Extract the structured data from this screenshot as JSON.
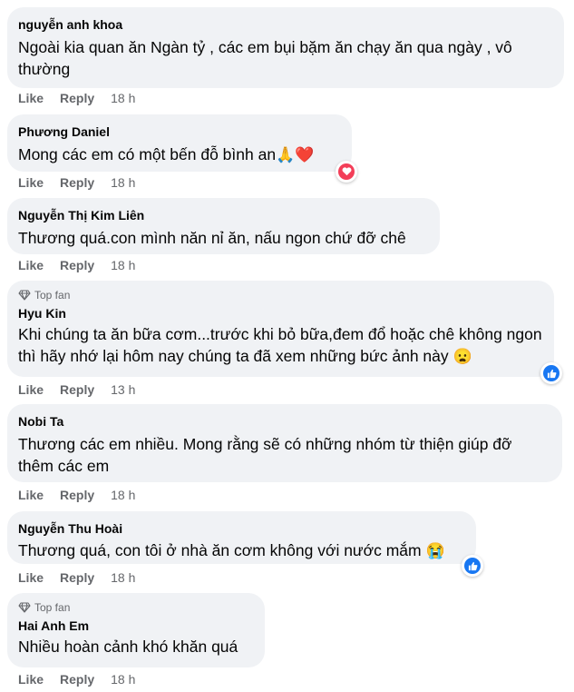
{
  "comments": [
    {
      "author": "nguyễn anh khoa",
      "text": "Ngoài kia quan ăn Ngàn tỷ , các em bụi bặm ăn chạy ăn qua ngày , vô thường",
      "like": "Like",
      "reply": "Reply",
      "time": "18 h"
    },
    {
      "author": "Phương Daniel",
      "text": "Mong các em có một bến đỗ bình an",
      "emoji": "🙏❤️",
      "reaction": "love-reaction",
      "like": "Like",
      "reply": "Reply",
      "time": "18 h"
    },
    {
      "author": "Nguyễn Thị Kim Liên",
      "text": "Thương quá.con mình năn nỉ ăn, nấu ngon chứ đỡ chê",
      "like": "Like",
      "reply": "Reply",
      "time": "18 h"
    },
    {
      "badge": "Top fan",
      "author": "Hyu Kin",
      "text": "Khi chúng ta ăn bữa cơm...trước khi bỏ bữa,đem đổ hoặc chê không ngon thì hãy nhớ lại hôm nay chúng ta đã xem những bức ảnh này",
      "emoji": "😦",
      "reaction": "like-reaction",
      "like": "Like",
      "reply": "Reply",
      "time": "13 h"
    },
    {
      "author": "Nobi Ta",
      "text": "Thương các em nhiều. Mong rằng sẽ có những nhóm từ thiện giúp đỡ thêm các em",
      "like": "Like",
      "reply": "Reply",
      "time": "18 h"
    },
    {
      "author": "Nguyễn Thu Hoài",
      "text": "Thương quá, con tôi ở nhà ăn cơm không với nước mắm",
      "emoji": "😭",
      "reaction": "like-reaction",
      "like": "Like",
      "reply": "Reply",
      "time": "18 h"
    },
    {
      "badge": "Top fan",
      "author": "Hai Anh Em",
      "text": "Nhiều hoàn cảnh khó khăn quá",
      "like": "Like",
      "reply": "Reply",
      "time": "18 h"
    }
  ],
  "colors": {
    "bubble": "#f0f2f5",
    "secondary": "#65676b",
    "like_blue": "#1877f2",
    "love_red": "#f33e58"
  }
}
